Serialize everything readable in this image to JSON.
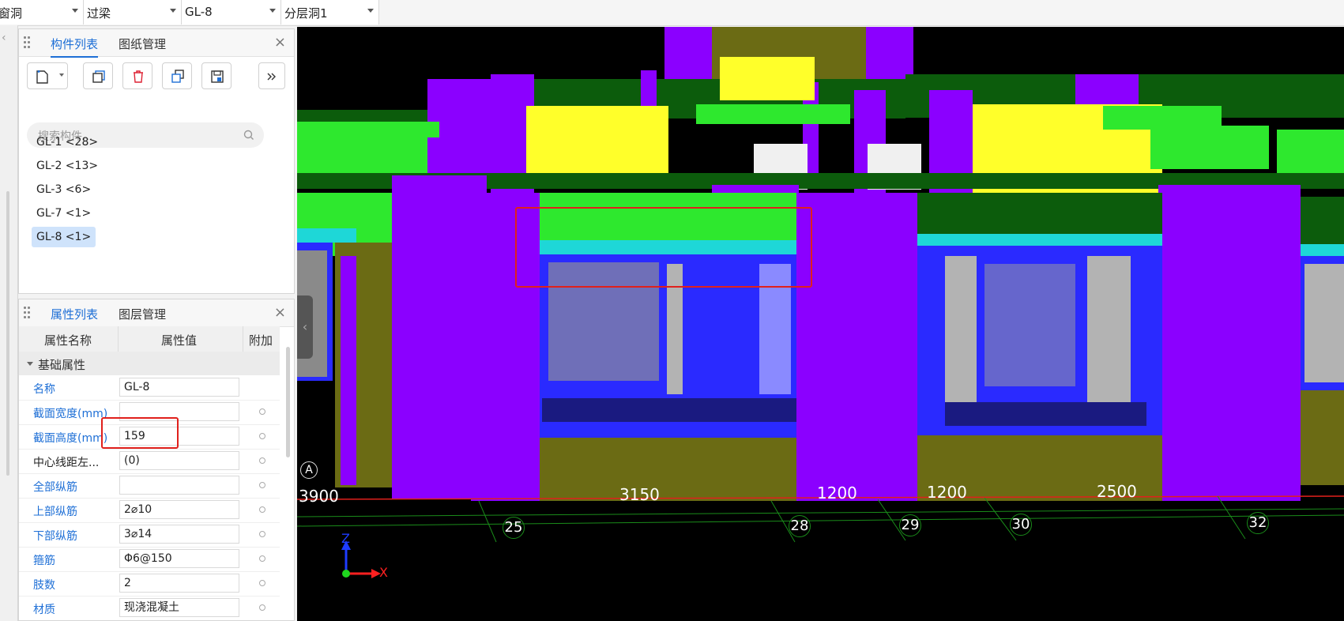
{
  "toolbar": {
    "dropdowns": [
      {
        "value": "窗洞"
      },
      {
        "value": "过梁"
      },
      {
        "value": "GL-8"
      },
      {
        "value": "分层洞1"
      }
    ]
  },
  "component_panel": {
    "tabs": [
      "构件列表",
      "图纸管理"
    ],
    "search_placeholder": "搜索构件...",
    "items": [
      "GL-1 <28>",
      "GL-2 <13>",
      "GL-3 <6>",
      "GL-7 <1>",
      "GL-8 <1>"
    ],
    "selected_index": 4
  },
  "property_panel": {
    "tabs": [
      "属性列表",
      "图层管理"
    ],
    "headers": [
      "属性名称",
      "属性值",
      "附加"
    ],
    "group": "基础属性",
    "rows": [
      {
        "name": "名称",
        "value": "GL-8"
      },
      {
        "name": "截面宽度(mm)",
        "value": ""
      },
      {
        "name": "截面高度(mm)",
        "value": "159"
      },
      {
        "name": "中心线距左...",
        "value": "(0)"
      },
      {
        "name": "全部纵筋",
        "value": ""
      },
      {
        "name": "上部纵筋",
        "value": "2⌀10"
      },
      {
        "name": "下部纵筋",
        "value": "3⌀14"
      },
      {
        "name": "箍筋",
        "value": "Φ6@150"
      },
      {
        "name": "肢数",
        "value": "2"
      },
      {
        "name": "材质",
        "value": "现浇混凝土"
      }
    ]
  },
  "viewport": {
    "axis_label": "A",
    "dimensions": [
      "3900",
      "3150",
      "1200",
      "1200",
      "2500"
    ],
    "grid_markers": [
      "25",
      "28",
      "29",
      "30",
      "32"
    ],
    "axes": {
      "z": "Z",
      "x": "X"
    },
    "colors": {
      "purple": "#8b00ff",
      "green": "#2ee82e",
      "dark_green": "#0c5c0c",
      "yellow": "#ffff2a",
      "olive": "#6b6b14",
      "cyan": "#1ed7d7",
      "blue": "#2a2aff",
      "highlight": "#e0201c"
    }
  }
}
